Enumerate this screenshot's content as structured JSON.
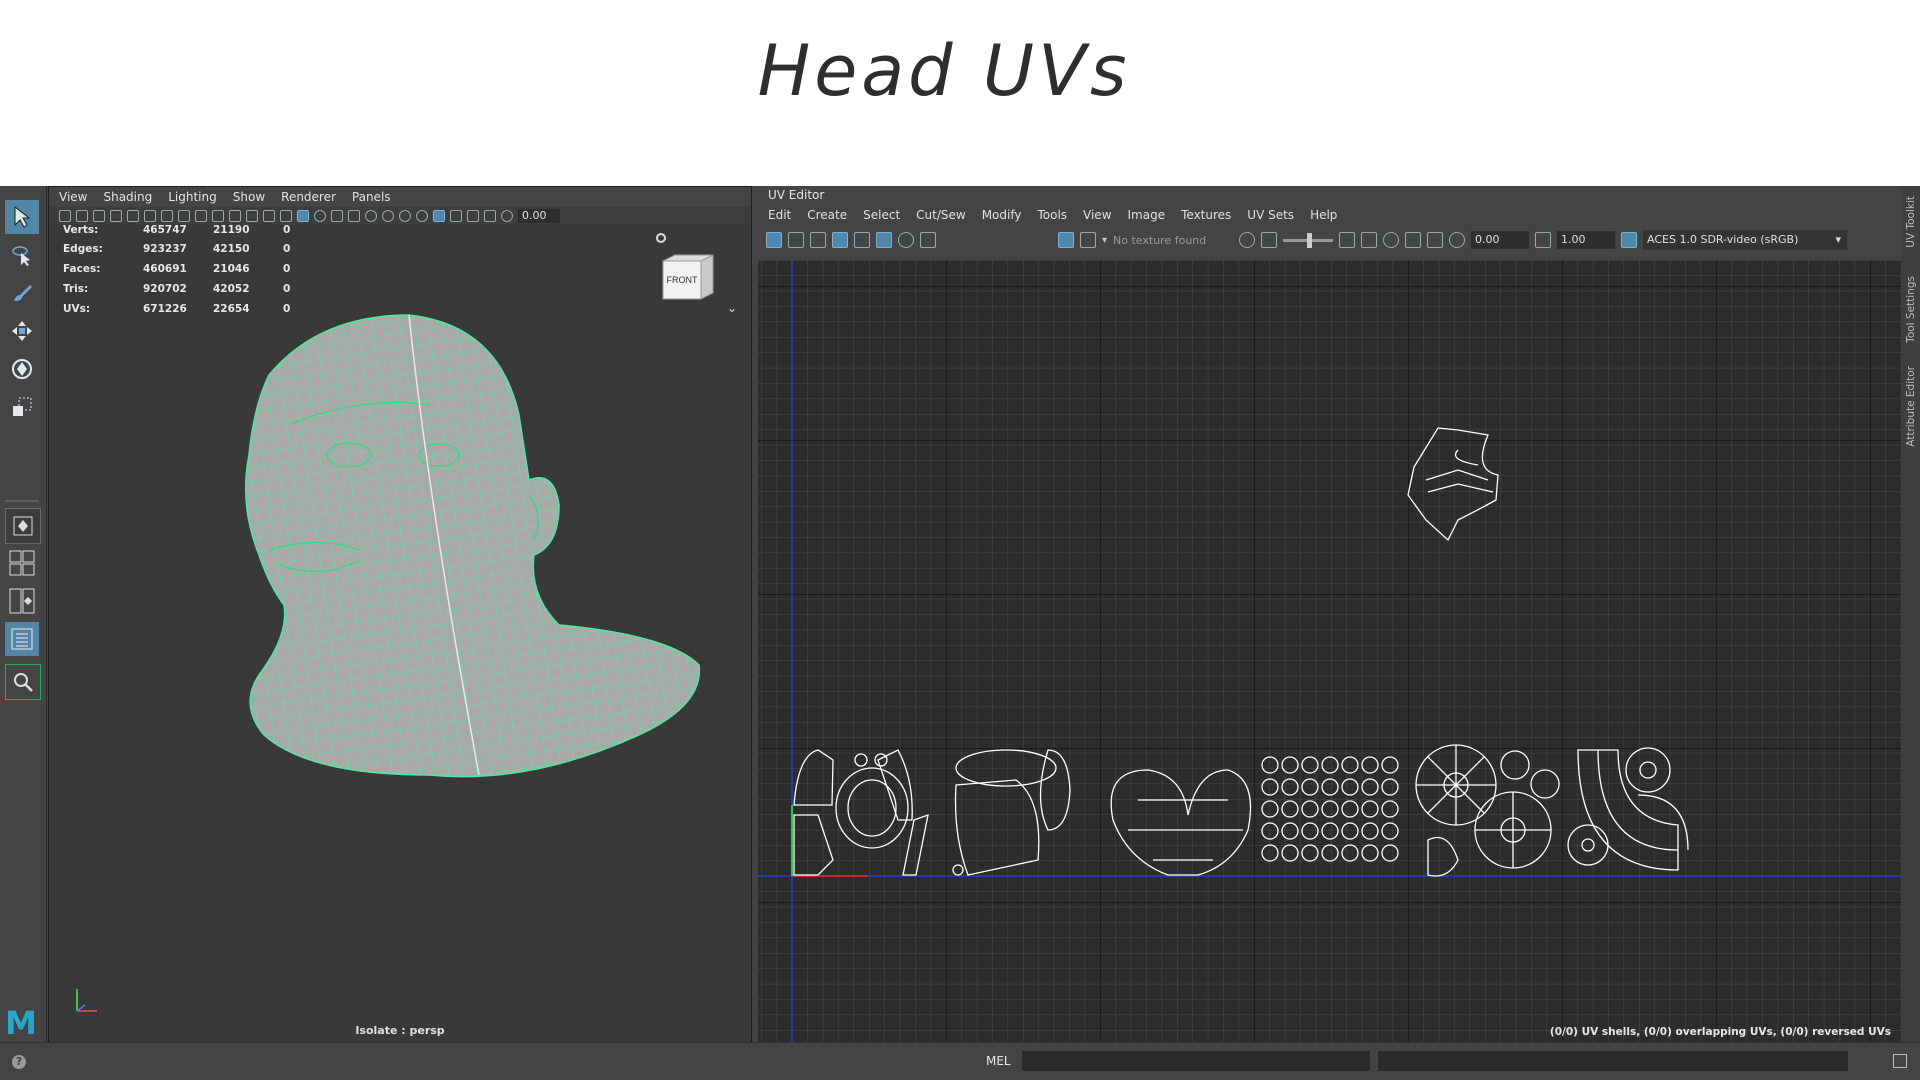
{
  "slide": {
    "title": "Head UVs"
  },
  "viewport": {
    "menu": [
      "View",
      "Shading",
      "Lighting",
      "Show",
      "Renderer",
      "Panels"
    ],
    "toolbar_value": "0.00",
    "hud": [
      {
        "label": "Verts:",
        "total": "465747",
        "selected": "21190",
        "extra": "0"
      },
      {
        "label": "Edges:",
        "total": "923237",
        "selected": "42150",
        "extra": "0"
      },
      {
        "label": "Faces:",
        "total": "460691",
        "selected": "21046",
        "extra": "0"
      },
      {
        "label": "Tris:",
        "total": "920702",
        "selected": "42052",
        "extra": "0"
      },
      {
        "label": "UVs:",
        "total": "671226",
        "selected": "22654",
        "extra": "0"
      }
    ],
    "viewcube_label": "FRONT",
    "isolate_label": "Isolate : persp"
  },
  "uv_editor": {
    "title": "UV Editor",
    "menu": [
      "Edit",
      "Create",
      "Select",
      "Cut/Sew",
      "Modify",
      "Tools",
      "View",
      "Image",
      "Textures",
      "UV Sets",
      "Help"
    ],
    "no_texture": "No texture found",
    "value_a": "0.00",
    "value_b": "1.00",
    "colorspace": "ACES 1.0 SDR-video (sRGB)",
    "status": "(0/0) UV shells, (0/0) overlapping UVs, (0/0) reversed UVs"
  },
  "side_tabs": [
    "UV Toolkit",
    "Tool Settings",
    "Attribute Editor"
  ],
  "command_line": {
    "mode": "MEL"
  },
  "colors": {
    "wire": "#4de8a6",
    "mesh": "#a7a7a7",
    "uv_lines": "#ffffff",
    "accent": "#5285a6"
  },
  "icons": [
    "select-icon",
    "lasso-icon",
    "paint-icon",
    "move-icon",
    "rotate-icon",
    "scale-icon",
    "search-icon",
    "help-icon"
  ]
}
